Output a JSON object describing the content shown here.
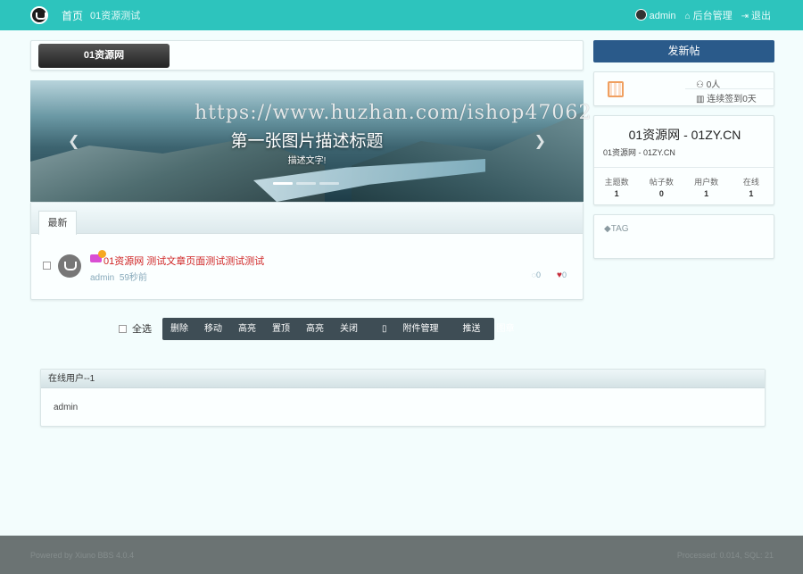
{
  "header": {
    "home": "首页",
    "site_name": "01资源测试",
    "user": "admin",
    "admin_link": "后台管理",
    "logout": "退出"
  },
  "site_title": "01资源网",
  "carousel": {
    "caption_title": "第一张图片描述标题",
    "caption_text": "描述文字!"
  },
  "watermark": "https://www.huzhan.com/ishop47062",
  "threads": {
    "tab": "最新",
    "items": [
      {
        "title": "01资源网 测试文章页面测试测试测试",
        "author": "admin",
        "time": "59秒前",
        "comments": "0",
        "likes": "0"
      }
    ]
  },
  "actions": {
    "select_all": "全选",
    "buttons": [
      "删除",
      "移动",
      "高亮",
      "置顶",
      "高亮",
      "关闭",
      "附件管理",
      "推送",
      "图章"
    ]
  },
  "online": {
    "title": "在线用户--1",
    "users": [
      "admin"
    ]
  },
  "sidebar": {
    "post_button": "发新帖",
    "signin": {
      "count": "0人",
      "days": "连续签到0天"
    },
    "site_name": "01资源网 - 01ZY.CN",
    "site_desc": "01资源网 - 01ZY.CN",
    "stats": [
      {
        "label": "主题数",
        "value": "1"
      },
      {
        "label": "帖子数",
        "value": "0"
      },
      {
        "label": "用户数",
        "value": "1"
      },
      {
        "label": "在线",
        "value": "1"
      }
    ],
    "tag_title": "TAG"
  },
  "footer": {
    "left": "Powered by Xiuno BBS 4.0.4",
    "right": "Processed: 0.014, SQL: 21"
  },
  "colors": {
    "topbar": "#2dc4bd",
    "post_button": "#2a5a8a",
    "action_bar": "#3e4d55",
    "footer": "#6b7373",
    "thread_title": "#d02424"
  }
}
